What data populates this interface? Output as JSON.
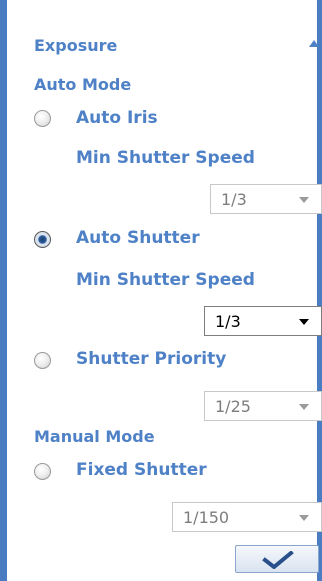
{
  "panel": {
    "title": "Exposure",
    "collapse_icon": "triangle-up-icon"
  },
  "auto_mode": {
    "heading": "Auto Mode",
    "options": [
      {
        "label": "Auto Iris",
        "selected": false,
        "sub_label": "Min Shutter Speed",
        "value": "1/3",
        "enabled": false
      },
      {
        "label": "Auto Shutter",
        "selected": true,
        "sub_label": "Min Shutter Speed",
        "value": "1/3",
        "enabled": true
      },
      {
        "label": "Shutter Priority",
        "selected": false,
        "value": "1/25",
        "enabled": false
      }
    ]
  },
  "manual_mode": {
    "heading": "Manual Mode",
    "options": [
      {
        "label": "Fixed Shutter",
        "selected": false,
        "value": "1/150",
        "enabled": false
      }
    ]
  },
  "apply_button": {
    "icon": "checkmark-icon"
  },
  "colors": {
    "accent": "#4f81c7",
    "border": "#4a7cc2"
  }
}
